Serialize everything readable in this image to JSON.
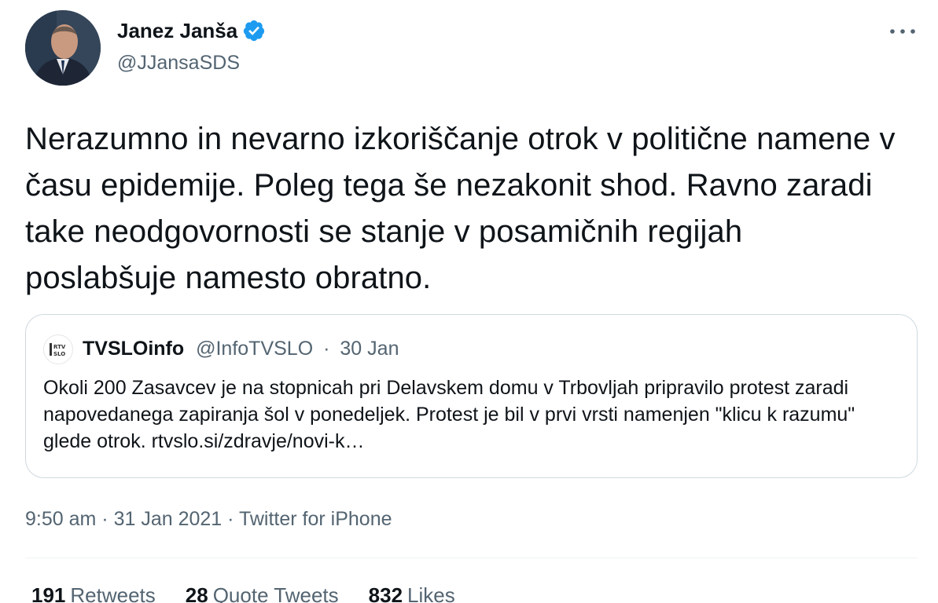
{
  "author": {
    "name": "Janez Janša",
    "handle": "@JJansaSDS"
  },
  "tweet": {
    "text": "Nerazumno in nevarno izkoriščanje otrok v politične namene v času epidemije. Poleg tega še nezakonit shod. Ravno zaradi take neodgovornosti se stanje v posamičnih regijah poslabšuje namesto obratno."
  },
  "quote": {
    "name": "TVSLOinfo",
    "handle": "@InfoTVSLO",
    "separator": "·",
    "date": "30 Jan",
    "text": "Okoli 200 Zasavcev je na stopnicah pri Delavskem domu v Trbovljah pripravilo protest zaradi napovedanega zapiranja šol v ponedeljek. Protest je bil v prvi vrsti namenjen \"klicu k razumu\" glede otrok. rtvslo.si/zdravje/novi-k…"
  },
  "meta": {
    "time": "9:50 am",
    "sep1": "·",
    "date": "31 Jan 2021",
    "sep2": "·",
    "source": "Twitter for iPhone"
  },
  "stats": {
    "retweets_count": "191",
    "retweets_label": "Retweets",
    "quotes_count": "28",
    "quotes_label": "Quote Tweets",
    "likes_count": "832",
    "likes_label": "Likes"
  },
  "colors": {
    "verified": "#1d9bf0",
    "secondary_text": "#536471",
    "border": "#cfd9de"
  },
  "icons": {
    "verified": "verified-badge-icon",
    "more": "more-horizontal-icon"
  }
}
